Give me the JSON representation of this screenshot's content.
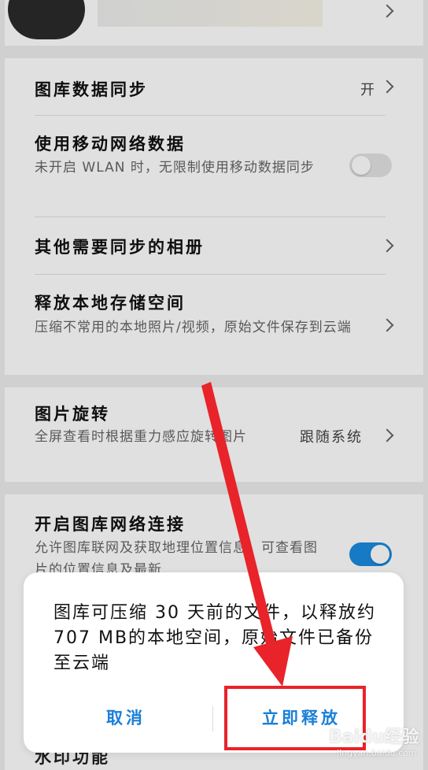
{
  "settings": {
    "gallery_sync": {
      "title": "图库数据同步",
      "value": "开"
    },
    "mobile_data": {
      "title": "使用移动网络数据",
      "subtitle": "未开启 WLAN 时，无限制使用移动数据同步",
      "enabled": false
    },
    "other_albums": {
      "title": "其他需要同步的相册"
    },
    "free_storage": {
      "title": "释放本地存储空间",
      "subtitle": "压缩不常用的本地照片/视频，原始文件保存到云端"
    },
    "rotation": {
      "title": "图片旋转",
      "subtitle": "全屏查看时根据重力感应旋转图片",
      "value": "跟随系统"
    },
    "network": {
      "title": "开启图库网络连接",
      "subtitle": "允许图库联网及获取地理位置信息，可查看图片的位置信息及最新",
      "enabled": true
    },
    "next_item": {
      "title": "水印功能"
    }
  },
  "dialog": {
    "message": "图库可压缩 30 天前的文件，以释放约707 MB的本地空间，原始文件已备份至云端",
    "cancel_label": "取消",
    "confirm_label": "立即释放"
  },
  "watermark": {
    "text": "Baidu经验",
    "sub": "jingyan.baidu.com"
  },
  "colors": {
    "accent": "#1a7fd6",
    "toggle_on": "#1a8be0",
    "annotation": "#e8232a"
  }
}
